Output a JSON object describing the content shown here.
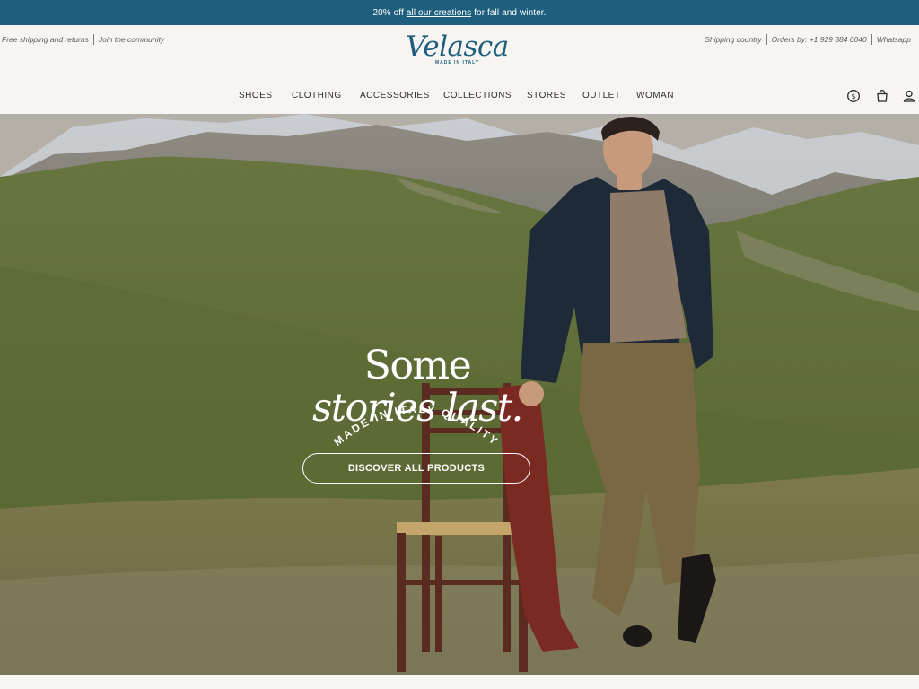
{
  "promo": {
    "prefix": "20% off",
    "link": "all our creations",
    "suffix": "for fall and winter."
  },
  "header": {
    "util_left": {
      "shipping": "Free shipping and returns",
      "community": "Join the community"
    },
    "util_right": {
      "country": "Shipping country",
      "orders": "Orders by: +1 929 384 6040",
      "whatsapp": "Whatsapp"
    },
    "logo": {
      "wordmark": "Velasca",
      "tagline": "MADE IN ITALY"
    },
    "nav": [
      "SHOES",
      "CLOTHING",
      "ACCESSORIES",
      "COLLECTIONS",
      "STORES",
      "OUTLET",
      "WOMAN"
    ],
    "icons": [
      "currency-icon",
      "shopping-bag-icon",
      "account-icon"
    ]
  },
  "hero": {
    "badge": "MADE IN ITALY QUALITY",
    "headline_line1": "Some",
    "headline_line2": "stories last.",
    "cta": "DISCOVER ALL PRODUCTS"
  },
  "colors": {
    "brand": "#1f5f7e",
    "page_bg": "#f7f5f2"
  }
}
